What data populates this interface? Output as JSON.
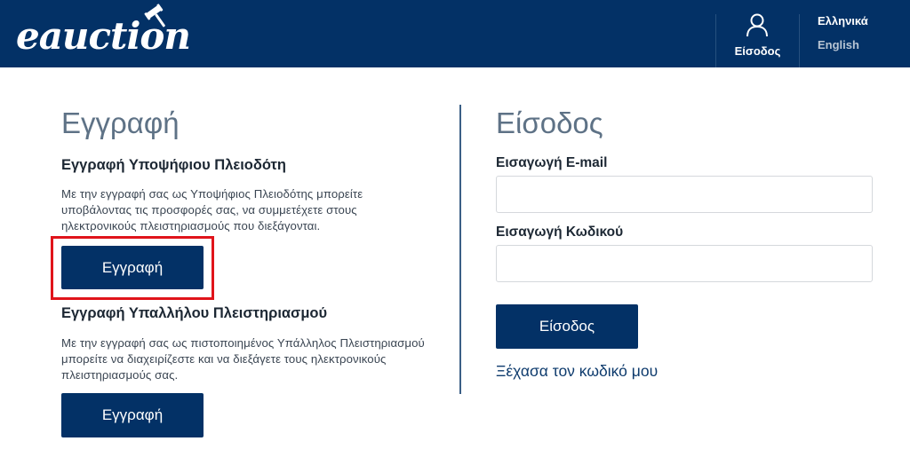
{
  "header": {
    "logo_text": "eauction",
    "login_label": "Είσοδος",
    "languages": [
      "Ελληνικά",
      "English"
    ]
  },
  "register": {
    "title": "Εγγραφή",
    "bidder": {
      "heading": "Εγγραφή Υποψήφιου Πλειοδότη",
      "description": "Με την εγγραφή σας ως Υποψήφιος Πλειοδότης μπορείτε υποβάλοντας τις προσφορές σας, να συμμετέχετε στους ηλεκτρονικούς πλειστηριασμούς που διεξάγονται.",
      "button_label": "Εγγραφή"
    },
    "employee": {
      "heading": "Εγγραφή Υπαλλήλου Πλειστηριασμού",
      "description": "Με την εγγραφή σας ως πιστοποιημένος Υπάλληλος Πλειστηριασμού μπορείτε να διαχειρίζεστε και να διεξάγετε τους ηλεκτρονικούς πλειστηριασμούς σας.",
      "button_label": "Εγγραφή"
    }
  },
  "login": {
    "title": "Είσοδος",
    "email_label": "Εισαγωγή E-mail",
    "email_value": "",
    "password_label": "Εισαγωγή Κωδικού",
    "password_value": "",
    "submit_label": "Είσοδος",
    "forgot_label": "Ξέχασα τον κωδικό μου"
  },
  "icons": {
    "gavel": "gavel-icon",
    "user": "user-icon"
  },
  "colors": {
    "brand_navy": "#033166",
    "highlight_red": "#e0141b",
    "title_gray": "#5e7286",
    "link_blue": "#0e3b6d"
  }
}
